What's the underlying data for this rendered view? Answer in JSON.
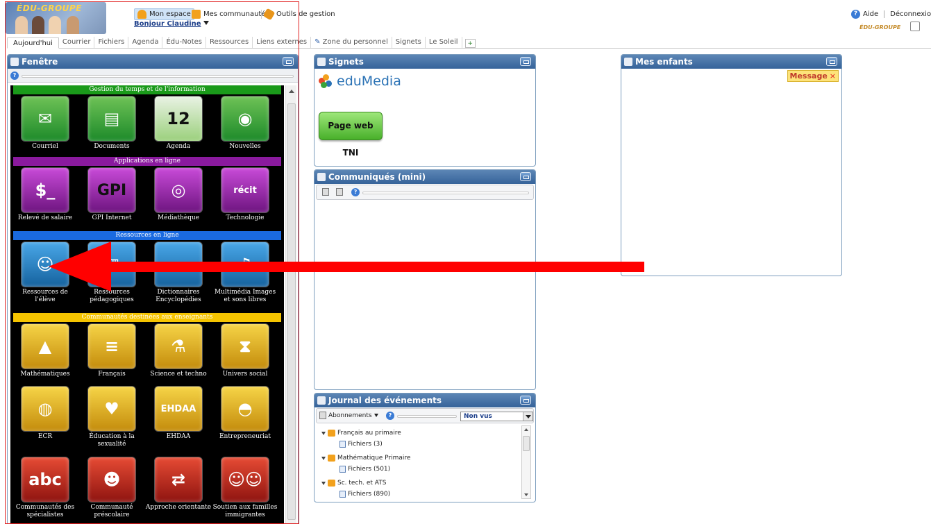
{
  "header": {
    "logo_text": "ÉDU-GROUPE",
    "mon_espace": "Mon espace",
    "mes_communautes": "Mes communautés",
    "outils_gestion": "Outils de gestion",
    "greeting": "Bonjour Claudine",
    "aide": "Aide",
    "deconnexion": "Déconnexion",
    "brand_small": "ÉDU-GROUPE"
  },
  "tabs": [
    "Aujourd'hui",
    "Courrier",
    "Fichiers",
    "Agenda",
    "Édu-Notes",
    "Ressources",
    "Liens externes",
    "Zone du personnel",
    "Signets",
    "Le Soleil"
  ],
  "fenetre": {
    "title": "Fenêtre",
    "sections": [
      {
        "label": "Gestion du temps et de l'information",
        "color": "#1a9a1a",
        "tiles": [
          {
            "label": "Courriel",
            "icon": "envelope-icon"
          },
          {
            "label": "Documents",
            "icon": "cabinet-icon"
          },
          {
            "label": "Agenda",
            "icon": "calendar-icon"
          },
          {
            "label": "Nouvelles",
            "icon": "rss-icon"
          }
        ]
      },
      {
        "label": "Applications en ligne",
        "color": "#8a1a9e",
        "tiles": [
          {
            "label": "Relevé de salaire",
            "icon": "terminal-icon"
          },
          {
            "label": "GPI Internet",
            "icon": "gpi-icon"
          },
          {
            "label": "Médiathèque",
            "icon": "regard-icon"
          },
          {
            "label": "Technologie",
            "icon": "recit-icon"
          }
        ]
      },
      {
        "label": "Ressources en ligne",
        "color": "#1a6ae0",
        "tiles": [
          {
            "label": "Ressources de l'élève",
            "icon": "student-icon"
          },
          {
            "label": "Ressources pédagogiques",
            "icon": "pedago-icon"
          },
          {
            "label": "Dictionnaires Encyclopédies",
            "icon": "book-icon"
          },
          {
            "label": "Multimédia Images et sons libres",
            "icon": "media-icon"
          }
        ]
      },
      {
        "label": "Communautés destinées aux enseignants",
        "color": "#f5c400",
        "tiles": [
          {
            "label": "Mathématiques",
            "icon": "math-icon"
          },
          {
            "label": "Français",
            "icon": "books-icon"
          },
          {
            "label": "Science et techno",
            "icon": "flask-icon"
          },
          {
            "label": "Univers social",
            "icon": "hourglass-icon"
          }
        ]
      },
      {
        "label": "",
        "color": "#000000",
        "tiles": [
          {
            "label": "ECR",
            "icon": "globe-icon"
          },
          {
            "label": "Éducation à la sexualité",
            "icon": "heart-icon"
          },
          {
            "label": "EHDAA",
            "icon": "ehdaa-icon"
          },
          {
            "label": "Entrepreneuriat",
            "icon": "helmet-icon"
          }
        ]
      },
      {
        "label": "",
        "color": "#000000",
        "tiles": [
          {
            "label": "Communautés des spécialistes",
            "icon": "abc-icon"
          },
          {
            "label": "Communauté préscolaire",
            "icon": "kids-icon"
          },
          {
            "label": "Approche orientante",
            "icon": "signpost-icon"
          },
          {
            "label": "Soutien aux familles immigrantes",
            "icon": "family-icon"
          }
        ]
      }
    ]
  },
  "signets": {
    "title": "Signets",
    "edumedia": "eduMedia",
    "tni": "Page web TNI"
  },
  "communiques": {
    "title": "Communiqués (mini)"
  },
  "journal": {
    "title": "Journal des événements",
    "abonnements": "Abonnements",
    "filter": "Non vus",
    "items": [
      {
        "group": "Français au primaire",
        "file": "Fichiers (3)"
      },
      {
        "group": "Mathématique Primaire",
        "file": "Fichiers (501)"
      },
      {
        "group": "Sc. tech. et ATS",
        "file": "Fichiers (890)"
      }
    ]
  },
  "enfants": {
    "title": "Mes enfants",
    "message": "Message"
  },
  "colors": {
    "header_blue": "#36639a",
    "annotation_red": "#e02020"
  }
}
